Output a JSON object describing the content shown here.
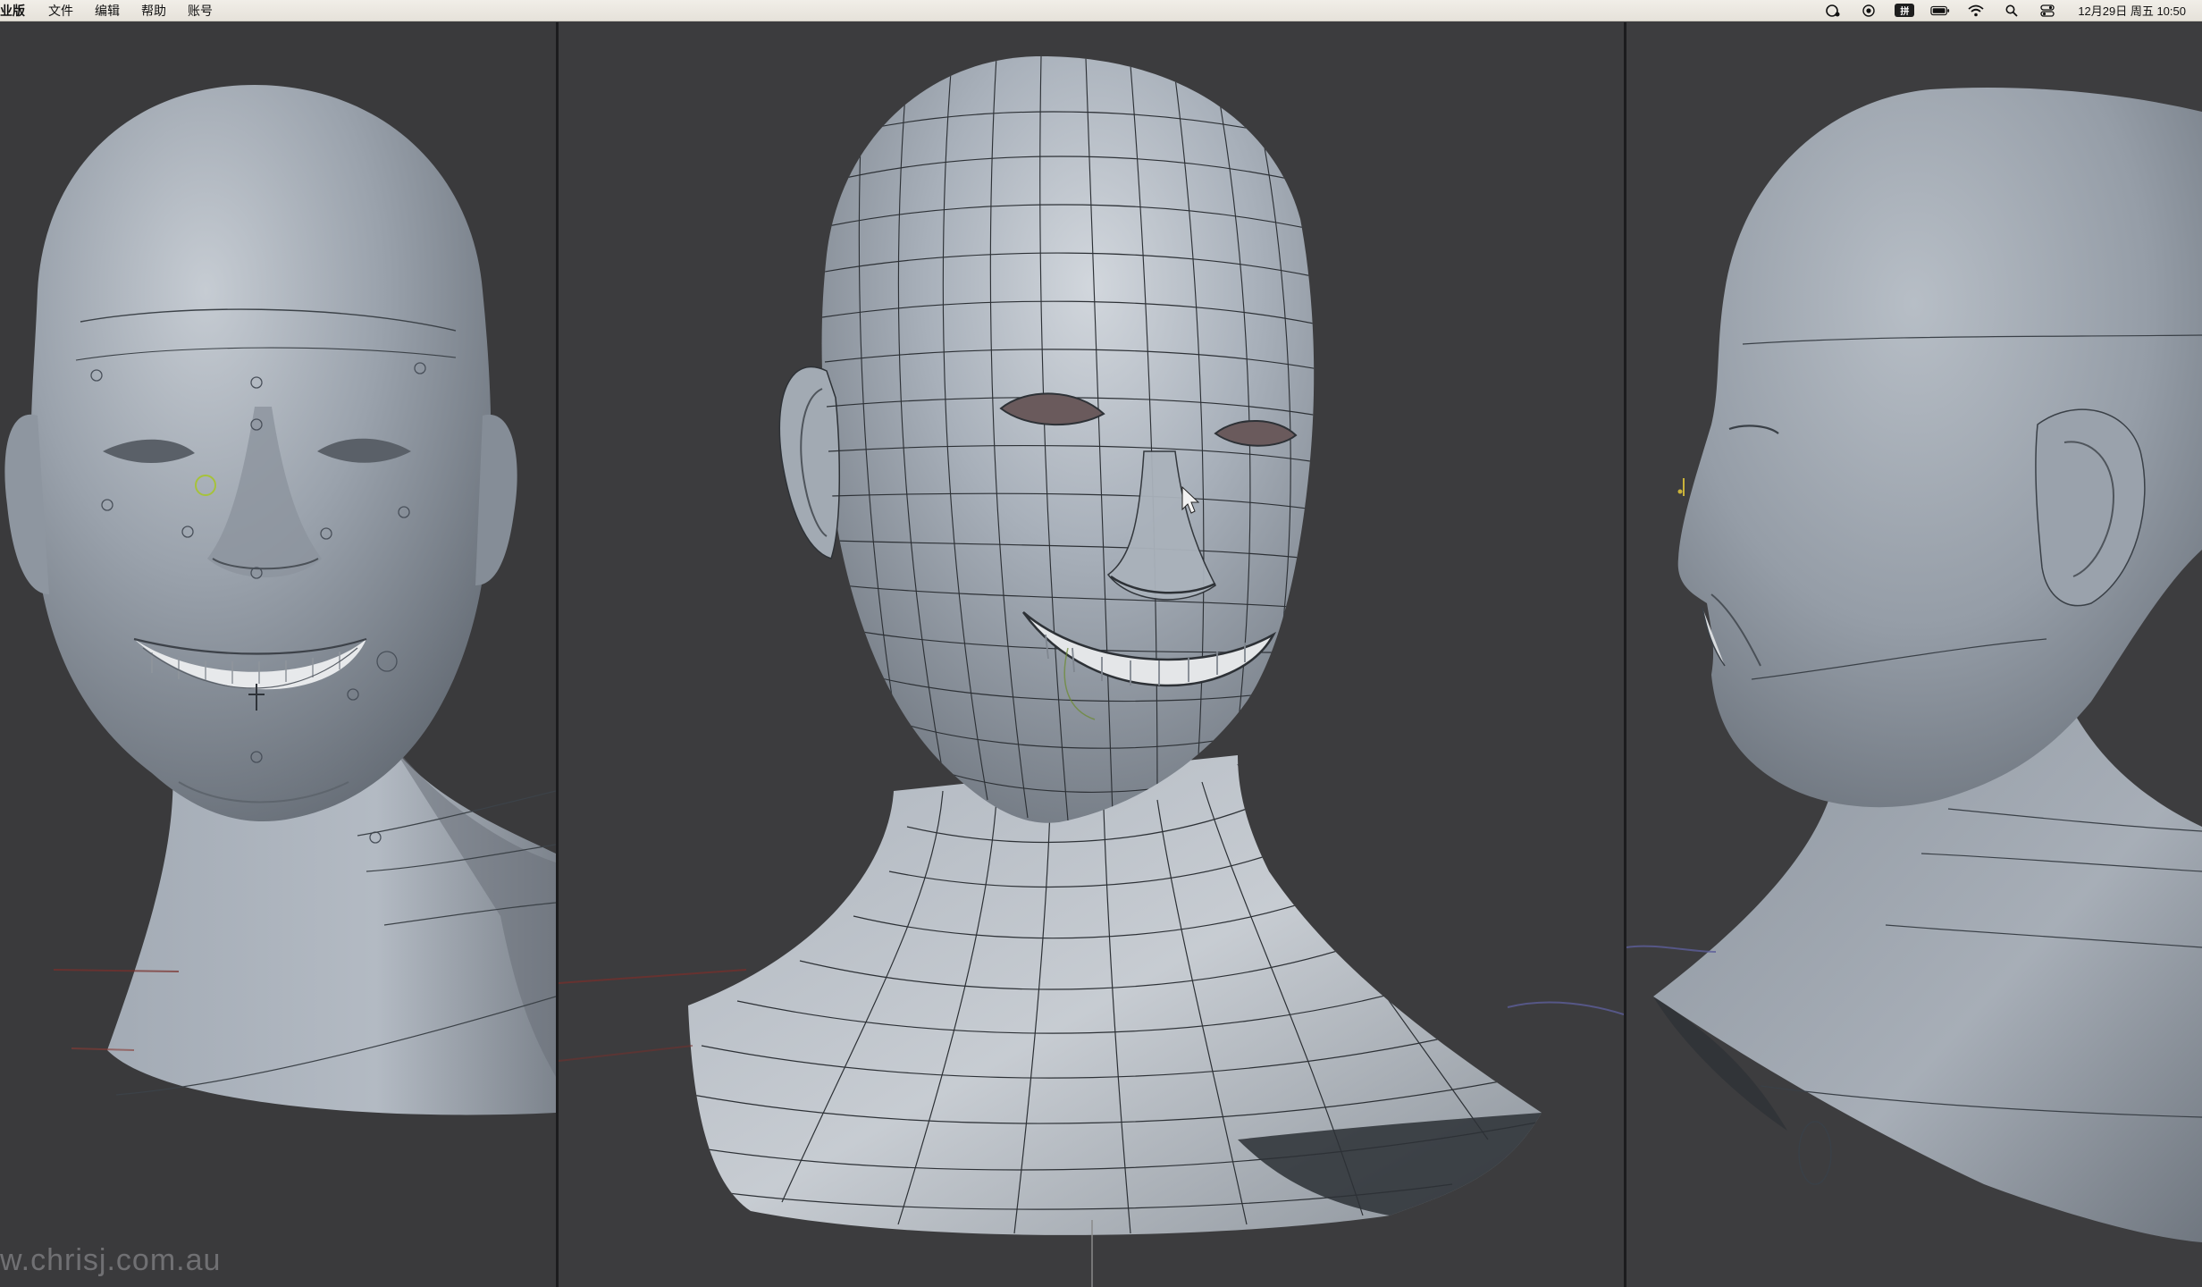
{
  "menubar": {
    "app_name": "业版",
    "menus": [
      "文件",
      "编辑",
      "帮助",
      "账号"
    ],
    "status_icons": [
      "screen-record-icon",
      "record-icon",
      "input-method-icon",
      "battery-icon",
      "wifi-icon",
      "search-icon",
      "control-center-icon"
    ],
    "input_method_label": "拼",
    "datetime": "12月29日 周五  10:50"
  },
  "viewport": {
    "panes": [
      "front-view",
      "perspective-view",
      "side-view"
    ],
    "watermark": "w.chrisj.com.au"
  },
  "colors": {
    "menubar_bg": "#ece8e1",
    "viewport_bg": "#3c3c3e",
    "pane_divider": "#1c1c1e",
    "mesh_skin": "#9aa3ad",
    "wire": "#2d3136"
  }
}
